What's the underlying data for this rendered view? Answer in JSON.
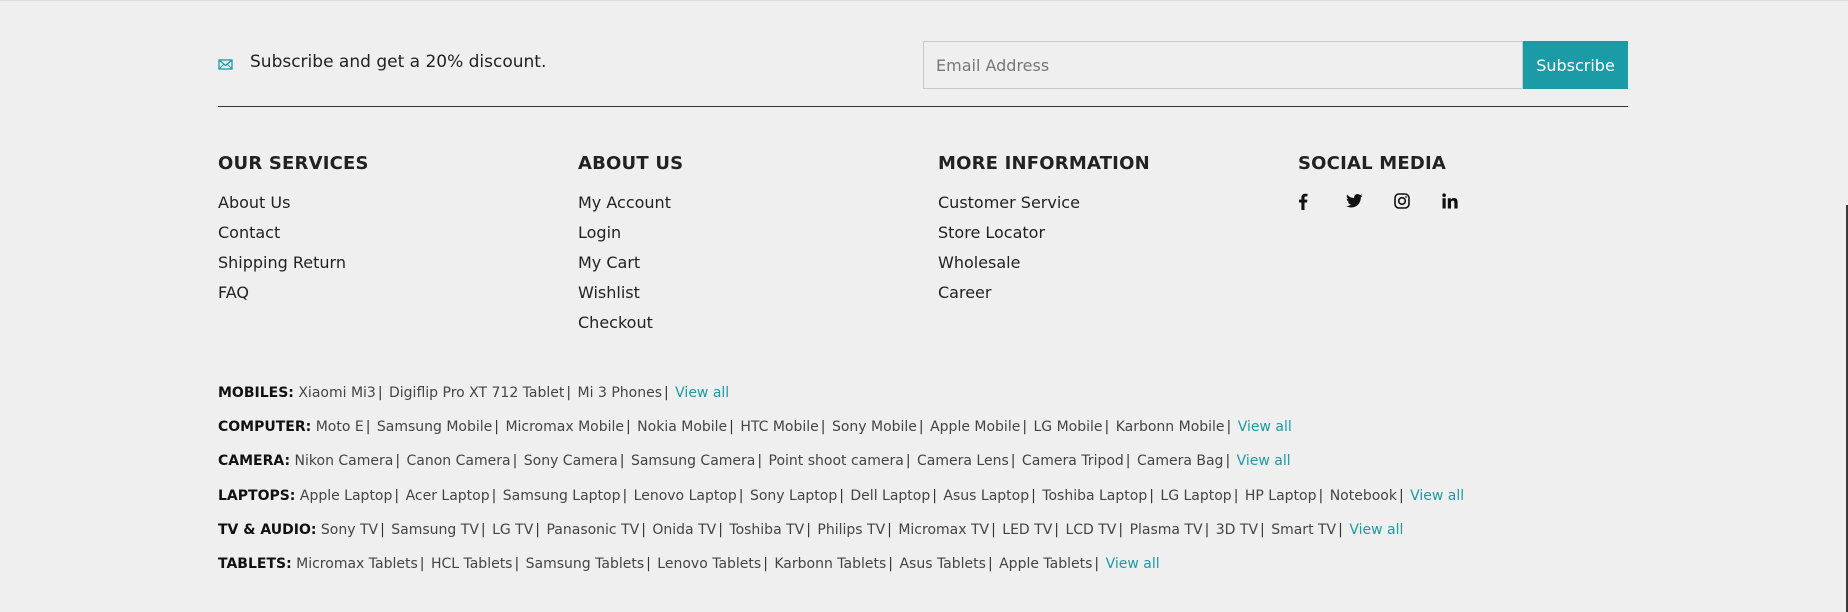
{
  "subscribe": {
    "text": "Subscribe and get a 20% discount.",
    "email_placeholder": "Email Address",
    "button_label": "Subscribe",
    "accent": "#1a9ba6"
  },
  "columns": {
    "services": {
      "title": "OUR SERVICES",
      "items": [
        "About Us",
        "Contact",
        "Shipping Return",
        "FAQ"
      ]
    },
    "about": {
      "title": "ABOUT US",
      "items": [
        "My Account",
        "Login",
        "My Cart",
        "Wishlist",
        "Checkout"
      ]
    },
    "more": {
      "title": "MORE INFORMATION",
      "items": [
        "Customer Service",
        "Store Locator",
        "Wholesale",
        "Career"
      ]
    },
    "social": {
      "title": "SOCIAL MEDIA",
      "icons": [
        "facebook-icon",
        "twitter-icon",
        "instagram-icon",
        "linkedin-icon"
      ]
    }
  },
  "categories": [
    {
      "label": "MOBILES:",
      "items": [
        "Xiaomi Mi3",
        "Digiflip Pro XT 712 Tablet",
        "Mi 3 Phones"
      ],
      "view_all": "View all"
    },
    {
      "label": "COMPUTER:",
      "items": [
        "Moto E",
        "Samsung Mobile",
        "Micromax Mobile",
        "Nokia Mobile",
        "HTC Mobile",
        "Sony Mobile",
        "Apple Mobile",
        "LG Mobile",
        "Karbonn Mobile"
      ],
      "view_all": "View all"
    },
    {
      "label": "CAMERA:",
      "items": [
        "Nikon Camera",
        "Canon Camera",
        "Sony Camera",
        "Samsung Camera",
        "Point shoot camera",
        "Camera Lens",
        "Camera Tripod",
        "Camera Bag"
      ],
      "view_all": "View all"
    },
    {
      "label": "LAPTOPS:",
      "items": [
        "Apple Laptop",
        "Acer Laptop",
        "Samsung Laptop",
        "Lenovo Laptop",
        "Sony Laptop",
        "Dell Laptop",
        "Asus Laptop",
        "Toshiba Laptop",
        "LG Laptop",
        "HP Laptop",
        "Notebook"
      ],
      "view_all": "View all"
    },
    {
      "label": "TV & AUDIO:",
      "items": [
        "Sony TV",
        "Samsung TV",
        "LG TV",
        "Panasonic TV",
        "Onida TV",
        "Toshiba TV",
        "Philips TV",
        "Micromax TV",
        "LED TV",
        "LCD TV",
        "Plasma TV",
        "3D TV",
        "Smart TV"
      ],
      "view_all": "View all"
    },
    {
      "label": "TABLETS:",
      "items": [
        "Micromax Tablets",
        "HCL Tablets",
        "Samsung Tablets",
        "Lenovo Tablets",
        "Karbonn Tablets",
        "Asus Tablets",
        "Apple Tablets"
      ],
      "view_all": "View all"
    }
  ]
}
